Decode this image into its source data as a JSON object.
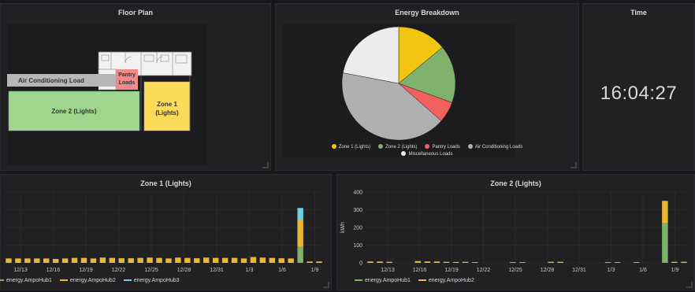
{
  "floor_plan": {
    "title": "Floor Plan",
    "labels": {
      "ac": "Air Conditioning Load",
      "pantry_line1": "Pantry",
      "pantry_line2": "Loads",
      "zone1_line1": "Zone 1",
      "zone1_line2": "(Lights)",
      "zone2": "Zone 2 (Lights)"
    },
    "colors": {
      "ac": "#b7b7b7",
      "pantry": "#f08a8a",
      "zone1": "#fadb5a",
      "zone2": "#9fd58c"
    }
  },
  "energy_breakdown": {
    "title": "Energy Breakdown",
    "chart_data": {
      "type": "pie",
      "title": "Energy Breakdown",
      "slices": [
        {
          "name": "Zone 1 (Lights)",
          "value": 14,
          "color": "#f2c511"
        },
        {
          "name": "Zone 2 (Lights)",
          "value": 16.5,
          "color": "#7eb26d"
        },
        {
          "name": "Pantry Loads",
          "value": 6,
          "color": "#f25f5c"
        },
        {
          "name": "Air Conditioning Loads",
          "value": 41.5,
          "color": "#b0b0b0"
        },
        {
          "name": "Miscellaneous Loads",
          "value": 22,
          "color": "#ececec"
        }
      ],
      "legend_position": "bottom"
    }
  },
  "time": {
    "title": "Time",
    "value": "16:04:27"
  },
  "zone1_graph": {
    "title": "Zone 1 (Lights)",
    "chart_data": {
      "type": "bar",
      "stacked": true,
      "x_ticks": [
        "12/13",
        "12/16",
        "12/19",
        "12/22",
        "12/25",
        "12/28",
        "12/31",
        "1/3",
        "1/6",
        "1/9"
      ],
      "ylim": [
        0,
        400
      ],
      "grid": true,
      "series": [
        {
          "name": "energy.AmpoHub1",
          "color": "#7eb26d",
          "values": [
            0,
            0,
            0,
            0,
            0,
            0,
            0,
            0,
            0,
            0,
            0,
            0,
            0,
            0,
            0,
            0,
            0,
            0,
            0,
            0,
            0,
            0,
            0,
            0,
            0,
            0,
            0,
            0,
            0,
            0,
            0,
            90,
            0,
            0
          ]
        },
        {
          "name": "energy.AmpoHub2",
          "color": "#eab839",
          "values": [
            25,
            25,
            25,
            25,
            25,
            22,
            25,
            28,
            28,
            25,
            30,
            28,
            26,
            26,
            28,
            30,
            28,
            25,
            30,
            28,
            26,
            30,
            28,
            28,
            28,
            25,
            33,
            30,
            28,
            26,
            25,
            150,
            8,
            8
          ]
        },
        {
          "name": "energy.AmpoHub3",
          "color": "#6ed0e0",
          "values": [
            0,
            0,
            0,
            0,
            0,
            0,
            0,
            0,
            0,
            0,
            0,
            0,
            0,
            0,
            0,
            0,
            0,
            0,
            0,
            0,
            0,
            0,
            0,
            0,
            0,
            0,
            0,
            0,
            0,
            0,
            0,
            70,
            0,
            0
          ]
        }
      ]
    }
  },
  "zone2_graph": {
    "title": "Zone 2 (Lights)",
    "chart_data": {
      "type": "bar",
      "stacked": true,
      "x_ticks": [
        "12/13",
        "12/16",
        "12/19",
        "12/22",
        "12/25",
        "12/28",
        "12/31",
        "1/3",
        "1/6",
        "1/9"
      ],
      "y_ticks": [
        "400",
        "300",
        "200",
        "100",
        "0"
      ],
      "ylabel": "kWh",
      "ylim": [
        0,
        400
      ],
      "grid": true,
      "series": [
        {
          "name": "energy.AmpoHub1",
          "color": "#7eb26d",
          "values": [
            0,
            0,
            0,
            0,
            0,
            0,
            0,
            0,
            0,
            0,
            0,
            0,
            0,
            0,
            0,
            0,
            0,
            0,
            0,
            0,
            0,
            0,
            0,
            0,
            0,
            0,
            0,
            0,
            0,
            0,
            0,
            225,
            0,
            0
          ]
        },
        {
          "name": "energy.AmpoHub2",
          "color": "#eab839",
          "values": [
            8,
            8,
            6,
            0,
            0,
            10,
            8,
            8,
            6,
            5,
            6,
            4,
            0,
            0,
            0,
            4,
            4,
            0,
            0,
            6,
            6,
            0,
            0,
            0,
            0,
            4,
            4,
            0,
            4,
            0,
            0,
            125,
            6,
            6
          ]
        }
      ]
    }
  }
}
